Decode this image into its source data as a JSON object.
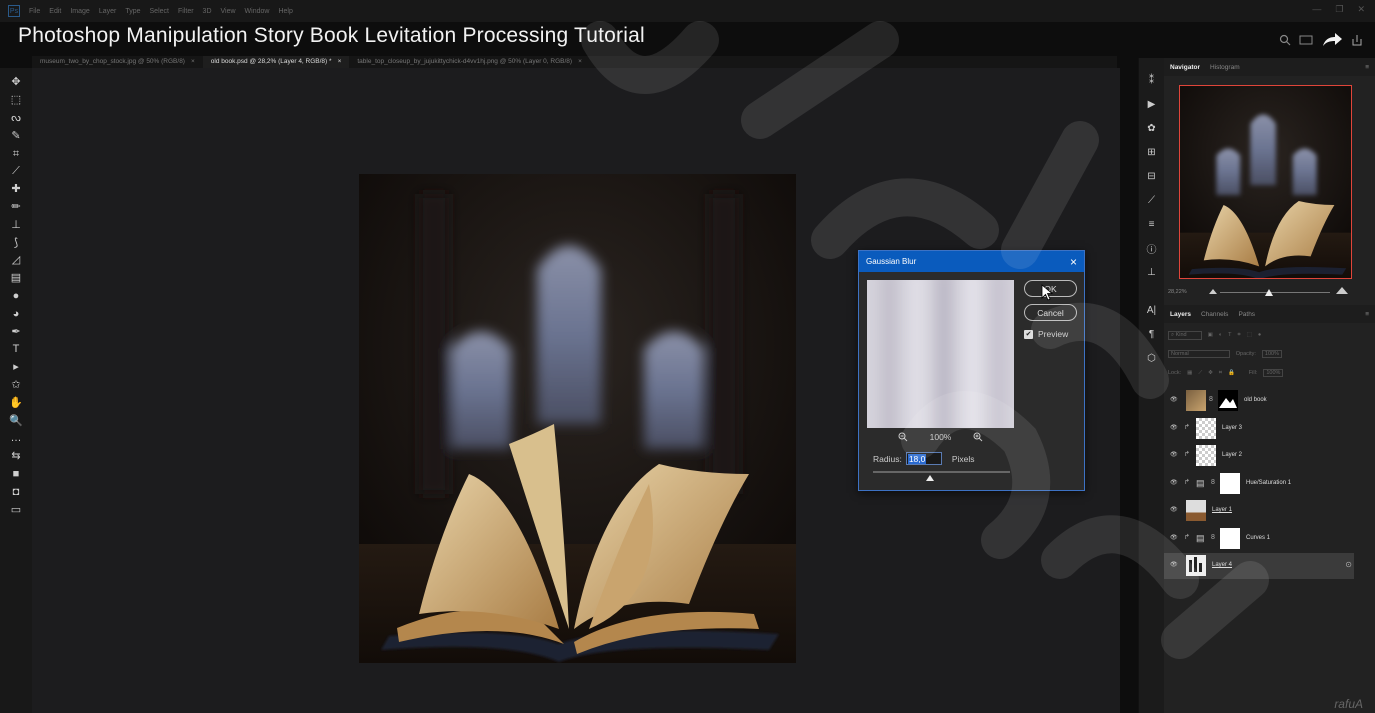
{
  "menubar": {
    "items": [
      "File",
      "Edit",
      "Image",
      "Layer",
      "Type",
      "Select",
      "Filter",
      "3D",
      "View",
      "Window",
      "Help"
    ]
  },
  "video_title": "Photoshop Manipulation Story Book Levitation Processing Tutorial",
  "tabs": [
    {
      "label": "museum_two_by_chop_stock.jpg @ 50% (RGB/8)",
      "close": "×",
      "active": false
    },
    {
      "label": "old book.psd @ 28,2% (Layer 4, RGB/8) *",
      "close": "×",
      "active": true
    },
    {
      "label": "table_top_closeup_by_jujukittychick-d4vv1hj.png @ 50% (Layer 0, RGB/8)",
      "close": "×",
      "active": false
    }
  ],
  "tools": [
    "move-icon",
    "marquee-icon",
    "lasso-icon",
    "quick-select-icon",
    "crop-icon",
    "eyedropper-icon",
    "healing-icon",
    "brush-icon",
    "stamp-icon",
    "history-brush-icon",
    "eraser-icon",
    "gradient-icon",
    "blur-icon",
    "dodge-icon",
    "pen-icon",
    "type-icon",
    "path-select-icon",
    "shape-icon",
    "hand-icon",
    "zoom-icon",
    "more-icon",
    "swap-icon",
    "colors-icon",
    "quickmask-icon",
    "screenmode-icon"
  ],
  "tool_glyphs": [
    "✥",
    "⬚",
    "ᔓ",
    "✎",
    "⌗",
    "⟋",
    "✚",
    "✏",
    "⊥",
    "⟆",
    "◿",
    "▤",
    "●",
    "◕",
    "✒",
    "T",
    "▸",
    "✩",
    "✋",
    "🔍",
    "…",
    "⇆",
    "■",
    "◘",
    "▭"
  ],
  "dialog": {
    "title": "Gaussian Blur",
    "close": "×",
    "ok_label": "OK",
    "cancel_label": "Cancel",
    "preview_label": "Preview",
    "preview_checked": true,
    "zoom_out": "−",
    "zoom_level": "100%",
    "zoom_in": "+",
    "radius_label": "Radius:",
    "radius_value": "18,0",
    "radius_unit": "Pixels"
  },
  "mid_strip_icons": [
    "history-icon",
    "play-icon",
    "3d-icon",
    "grid-icon",
    "swatches-icon",
    "brushes-icon",
    "adjust-icon",
    "info-icon",
    "stamp-panel-icon",
    "character-icon",
    "paragraph-icon",
    "cube-icon"
  ],
  "mid_strip_glyphs": [
    "⁑",
    "▶",
    "✿",
    "⊞",
    "⊟",
    "⟋",
    "≡",
    "ⓘ",
    "⊥",
    "A|",
    "¶",
    "⬡"
  ],
  "navigator": {
    "tabs": [
      "Navigator",
      "Histogram"
    ],
    "zoom": "28,22%"
  },
  "layers_panel": {
    "tabs": [
      "Layers",
      "Channels",
      "Paths"
    ],
    "kind_label": "Kind",
    "blend_mode": "Normal",
    "opacity_label": "Opacity:",
    "opacity_value": "100%",
    "lock_label": "Lock:",
    "fill_label": "Fill:",
    "fill_value": "100%",
    "layers": [
      {
        "name": "old book",
        "type": "masked",
        "clipped": false
      },
      {
        "name": "Layer 3",
        "type": "pixel",
        "clipped": true
      },
      {
        "name": "Layer 2",
        "type": "pixel",
        "clipped": true
      },
      {
        "name": "Hue/Saturation 1",
        "type": "adjustment",
        "clipped": true
      },
      {
        "name": "Layer 1",
        "type": "pixel",
        "clipped": false
      },
      {
        "name": "Curves 1",
        "type": "adjustment",
        "clipped": true
      },
      {
        "name": "Layer 4",
        "type": "smart",
        "clipped": false,
        "selected": true
      }
    ]
  },
  "watermark": "rafuA",
  "colors": {
    "accent": "#0a5bbd",
    "nav_frame": "#e0453a"
  }
}
